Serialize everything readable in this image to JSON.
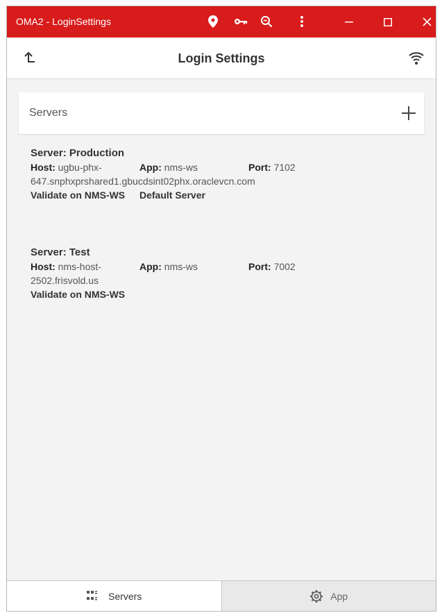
{
  "window": {
    "title": "OMA2 - LoginSettings",
    "accent_color": "#d81b1b",
    "toolbar_icons": [
      "location-pin-icon",
      "key-icon",
      "zoom-icon",
      "more-vert-icon"
    ],
    "window_controls": [
      "minimize-icon",
      "maximize-icon",
      "close-icon"
    ]
  },
  "appbar": {
    "title": "Login Settings",
    "back_icon": "back-up-arrow-icon",
    "status_icon": "wifi-icon"
  },
  "servers_section": {
    "label": "Servers",
    "add_icon": "plus-icon"
  },
  "servers": [
    {
      "name": "Server: Production",
      "host_label": "Host:",
      "host_value_line1": "ugbu-phx-",
      "host_value_line2": "647.snphxprshared1.gbucdsint02phx.oraclevcn.com",
      "app_label": "App:",
      "app_value": "nms-ws",
      "port_label": "Port:",
      "port_value": "7102",
      "validate_text": "Validate on NMS-WS",
      "default_text": "Default Server"
    },
    {
      "name": "Server: Test",
      "host_label": "Host:",
      "host_value_line1": "nms-host-",
      "host_value_line2": "2502.frisvold.us",
      "app_label": "App:",
      "app_value": "nms-ws",
      "port_label": "Port:",
      "port_value": "7002",
      "validate_text": "Validate on NMS-WS"
    }
  ],
  "bottom_nav": {
    "tabs": [
      {
        "label": "Servers",
        "icon": "servers-grid-icon",
        "active": true
      },
      {
        "label": "App",
        "icon": "gear-icon",
        "active": false
      }
    ]
  }
}
